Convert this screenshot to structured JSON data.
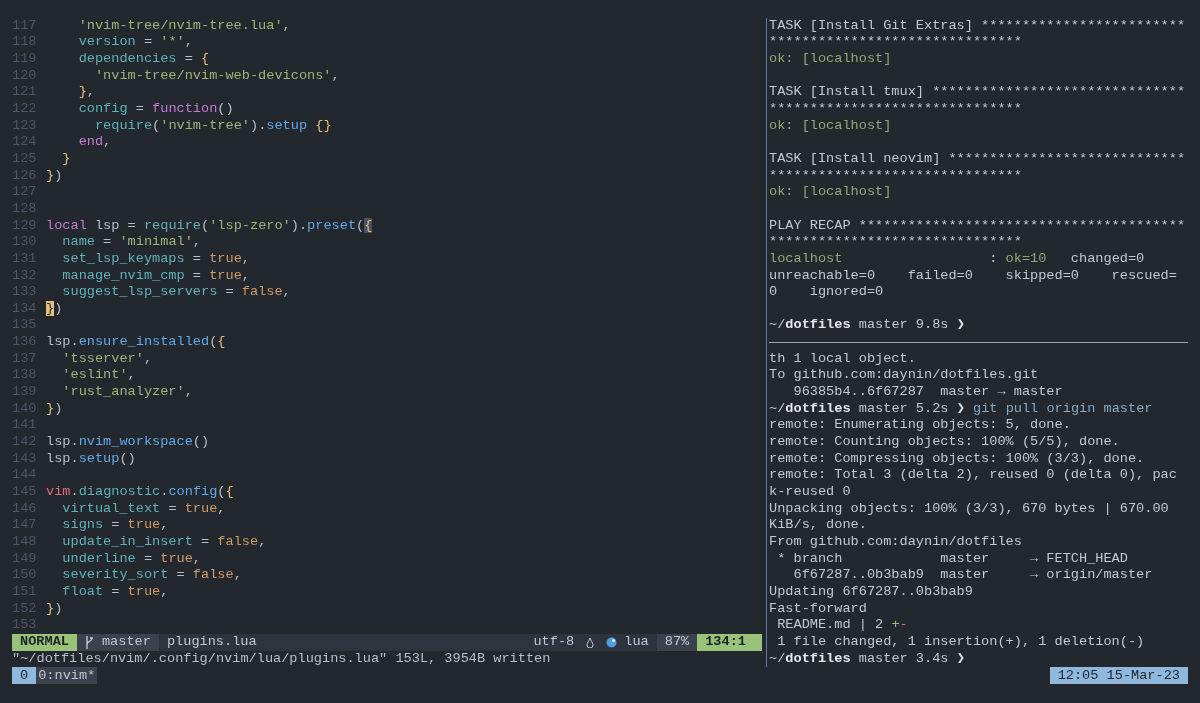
{
  "editor": {
    "lines": [
      {
        "number": "117",
        "tokens": [
          {
            "text": "    'nvim-tree/nvim-tree.lua'",
            "kind": "string"
          },
          {
            "text": ",",
            "kind": "plain"
          }
        ]
      },
      {
        "number": "118",
        "tokens": [
          {
            "text": "    version",
            "kind": "key"
          },
          {
            "text": " = ",
            "kind": "plain"
          },
          {
            "text": "'*'",
            "kind": "string"
          },
          {
            "text": ",",
            "kind": "plain"
          }
        ]
      },
      {
        "number": "119",
        "tokens": [
          {
            "text": "    dependencies",
            "kind": "key"
          },
          {
            "text": " = ",
            "kind": "plain"
          },
          {
            "text": "{",
            "kind": "brace"
          }
        ]
      },
      {
        "number": "120",
        "tokens": [
          {
            "text": "      'nvim-tree/nvim-web-devicons'",
            "kind": "string"
          },
          {
            "text": ",",
            "kind": "plain"
          }
        ]
      },
      {
        "number": "121",
        "tokens": [
          {
            "text": "    }",
            "kind": "brace"
          },
          {
            "text": ",",
            "kind": "plain"
          }
        ]
      },
      {
        "number": "122",
        "tokens": [
          {
            "text": "    config",
            "kind": "key"
          },
          {
            "text": " = ",
            "kind": "plain"
          },
          {
            "text": "function",
            "kind": "keyword"
          },
          {
            "text": "()",
            "kind": "plain"
          }
        ]
      },
      {
        "number": "123",
        "tokens": [
          {
            "text": "      require",
            "kind": "key"
          },
          {
            "text": "(",
            "kind": "plain"
          },
          {
            "text": "'nvim-tree'",
            "kind": "string"
          },
          {
            "text": ").",
            "kind": "plain"
          },
          {
            "text": "setup",
            "kind": "func"
          },
          {
            "text": " {}",
            "kind": "brace"
          }
        ]
      },
      {
        "number": "124",
        "tokens": [
          {
            "text": "    end",
            "kind": "keyword"
          },
          {
            "text": ",",
            "kind": "plain"
          }
        ]
      },
      {
        "number": "125",
        "tokens": [
          {
            "text": "  }",
            "kind": "brace"
          }
        ]
      },
      {
        "number": "126",
        "tokens": [
          {
            "text": "}",
            "kind": "brace"
          },
          {
            "text": ")",
            "kind": "plain"
          }
        ]
      },
      {
        "number": "127"
      },
      {
        "number": "128"
      },
      {
        "number": "129",
        "tokens": [
          {
            "text": "local",
            "kind": "keyword"
          },
          {
            "text": " lsp = ",
            "kind": "plain"
          },
          {
            "text": "require",
            "kind": "key"
          },
          {
            "text": "(",
            "kind": "plain"
          },
          {
            "text": "'lsp-zero'",
            "kind": "string"
          },
          {
            "text": ").",
            "kind": "plain"
          },
          {
            "text": "preset",
            "kind": "func"
          },
          {
            "text": "(",
            "kind": "plain"
          },
          {
            "text": "{",
            "kind": "match"
          }
        ]
      },
      {
        "number": "130",
        "tokens": [
          {
            "text": "  name",
            "kind": "key"
          },
          {
            "text": " = ",
            "kind": "plain"
          },
          {
            "text": "'minimal'",
            "kind": "string"
          },
          {
            "text": ",",
            "kind": "plain"
          }
        ]
      },
      {
        "number": "131",
        "tokens": [
          {
            "text": "  set_lsp_keymaps",
            "kind": "key"
          },
          {
            "text": " = ",
            "kind": "plain"
          },
          {
            "text": "true",
            "kind": "bool"
          },
          {
            "text": ",",
            "kind": "plain"
          }
        ]
      },
      {
        "number": "132",
        "tokens": [
          {
            "text": "  manage_nvim_cmp",
            "kind": "key"
          },
          {
            "text": " = ",
            "kind": "plain"
          },
          {
            "text": "true",
            "kind": "bool"
          },
          {
            "text": ",",
            "kind": "plain"
          }
        ]
      },
      {
        "number": "133",
        "tokens": [
          {
            "text": "  suggest_lsp_servers",
            "kind": "key"
          },
          {
            "text": " = ",
            "kind": "plain"
          },
          {
            "text": "false",
            "kind": "bool"
          },
          {
            "text": ",",
            "kind": "plain"
          }
        ]
      },
      {
        "number": "134",
        "tokens": [
          {
            "text": "}",
            "kind": "cursor"
          },
          {
            "text": ")",
            "kind": "plain"
          }
        ]
      },
      {
        "number": "135"
      },
      {
        "number": "136",
        "tokens": [
          {
            "text": "lsp.",
            "kind": "plain"
          },
          {
            "text": "ensure_installed",
            "kind": "func"
          },
          {
            "text": "(",
            "kind": "plain"
          },
          {
            "text": "{",
            "kind": "brace"
          }
        ]
      },
      {
        "number": "137",
        "tokens": [
          {
            "text": "  'tsserver'",
            "kind": "string"
          },
          {
            "text": ",",
            "kind": "plain"
          }
        ]
      },
      {
        "number": "138",
        "tokens": [
          {
            "text": "  'eslint'",
            "kind": "string"
          },
          {
            "text": ",",
            "kind": "plain"
          }
        ]
      },
      {
        "number": "139",
        "tokens": [
          {
            "text": "  'rust_analyzer'",
            "kind": "string"
          },
          {
            "text": ",",
            "kind": "plain"
          }
        ]
      },
      {
        "number": "140",
        "tokens": [
          {
            "text": "}",
            "kind": "brace"
          },
          {
            "text": ")",
            "kind": "plain"
          }
        ]
      },
      {
        "number": "141"
      },
      {
        "number": "142",
        "tokens": [
          {
            "text": "lsp.",
            "kind": "plain"
          },
          {
            "text": "nvim_workspace",
            "kind": "func"
          },
          {
            "text": "()",
            "kind": "plain"
          }
        ]
      },
      {
        "number": "143",
        "tokens": [
          {
            "text": "lsp.",
            "kind": "plain"
          },
          {
            "text": "setup",
            "kind": "func"
          },
          {
            "text": "()",
            "kind": "plain"
          }
        ]
      },
      {
        "number": "144"
      },
      {
        "number": "145",
        "tokens": [
          {
            "text": "vim",
            "kind": "var"
          },
          {
            "text": ".",
            "kind": "plain"
          },
          {
            "text": "diagnostic",
            "kind": "key"
          },
          {
            "text": ".",
            "kind": "plain"
          },
          {
            "text": "config",
            "kind": "func"
          },
          {
            "text": "(",
            "kind": "plain"
          },
          {
            "text": "{",
            "kind": "brace"
          }
        ]
      },
      {
        "number": "146",
        "tokens": [
          {
            "text": "  virtual_text",
            "kind": "key"
          },
          {
            "text": " = ",
            "kind": "plain"
          },
          {
            "text": "true",
            "kind": "bool"
          },
          {
            "text": ",",
            "kind": "plain"
          }
        ]
      },
      {
        "number": "147",
        "tokens": [
          {
            "text": "  signs",
            "kind": "key"
          },
          {
            "text": " = ",
            "kind": "plain"
          },
          {
            "text": "true",
            "kind": "bool"
          },
          {
            "text": ",",
            "kind": "plain"
          }
        ]
      },
      {
        "number": "148",
        "tokens": [
          {
            "text": "  update_in_insert",
            "kind": "key"
          },
          {
            "text": " = ",
            "kind": "plain"
          },
          {
            "text": "false",
            "kind": "bool"
          },
          {
            "text": ",",
            "kind": "plain"
          }
        ]
      },
      {
        "number": "149",
        "tokens": [
          {
            "text": "  underline",
            "kind": "key"
          },
          {
            "text": " = ",
            "kind": "plain"
          },
          {
            "text": "true",
            "kind": "bool"
          },
          {
            "text": ",",
            "kind": "plain"
          }
        ]
      },
      {
        "number": "150",
        "tokens": [
          {
            "text": "  severity_sort",
            "kind": "key"
          },
          {
            "text": " = ",
            "kind": "plain"
          },
          {
            "text": "false",
            "kind": "bool"
          },
          {
            "text": ",",
            "kind": "plain"
          }
        ]
      },
      {
        "number": "151",
        "tokens": [
          {
            "text": "  float",
            "kind": "key"
          },
          {
            "text": " = ",
            "kind": "plain"
          },
          {
            "text": "true",
            "kind": "bool"
          },
          {
            "text": ",",
            "kind": "plain"
          }
        ]
      },
      {
        "number": "152",
        "tokens": [
          {
            "text": "}",
            "kind": "brace"
          },
          {
            "text": ")",
            "kind": "plain"
          }
        ]
      },
      {
        "number": "153"
      }
    ],
    "status_line": {
      "mode": "NORMAL",
      "branch": "master",
      "file": "plugins.lua",
      "encoding": "utf-8",
      "filetype": "lua",
      "percent": "87%",
      "position": "134:1"
    },
    "message": "\"~/dotfiles/nvim/.config/nvim/lua/plugins.lua\" 153L, 3954B written"
  },
  "top_pane": {
    "lines": [
      {
        "segments": [
          {
            "text": "TASK [Install Git Extras] *************************",
            "kind": "plain"
          }
        ]
      },
      {
        "segments": [
          {
            "text": "*******************************",
            "kind": "plain"
          }
        ]
      },
      {
        "segments": [
          {
            "text": "ok: [localhost]",
            "kind": "ok"
          }
        ]
      },
      {
        "blank": true
      },
      {
        "segments": [
          {
            "text": "TASK [Install tmux] *******************************",
            "kind": "plain"
          }
        ]
      },
      {
        "segments": [
          {
            "text": "*******************************",
            "kind": "plain"
          }
        ]
      },
      {
        "segments": [
          {
            "text": "ok: [localhost]",
            "kind": "ok"
          }
        ]
      },
      {
        "blank": true
      },
      {
        "segments": [
          {
            "text": "TASK [Install neovim] *****************************",
            "kind": "plain"
          }
        ]
      },
      {
        "segments": [
          {
            "text": "*******************************",
            "kind": "plain"
          }
        ]
      },
      {
        "segments": [
          {
            "text": "ok: [localhost]",
            "kind": "ok"
          }
        ]
      },
      {
        "blank": true
      },
      {
        "segments": [
          {
            "text": "PLAY RECAP ****************************************",
            "kind": "plain"
          }
        ]
      },
      {
        "segments": [
          {
            "text": "*******************************",
            "kind": "plain"
          }
        ]
      },
      {
        "segments": [
          {
            "text": "localhost",
            "kind": "ok"
          },
          {
            "text": "                  : ",
            "kind": "plain"
          },
          {
            "text": "ok=10",
            "kind": "ok"
          },
          {
            "text": "   changed=0",
            "kind": "plain"
          }
        ]
      },
      {
        "segments": [
          {
            "text": "unreachable=0    failed=0    skipped=0    rescued=",
            "kind": "plain"
          }
        ]
      },
      {
        "segments": [
          {
            "text": "0    ignored=0",
            "kind": "plain"
          }
        ]
      },
      {
        "blank": true
      },
      {
        "segments": [
          {
            "text": "~/",
            "kind": "plain"
          },
          {
            "text": "dotfiles",
            "kind": "bold"
          },
          {
            "text": " master 9.8s",
            "kind": "plain"
          },
          {
            "text": " ❯",
            "kind": "bold"
          }
        ]
      }
    ]
  },
  "bottom_pane": {
    "lines": [
      {
        "segments": [
          {
            "text": "th 1 local object.",
            "kind": "plain"
          }
        ]
      },
      {
        "segments": [
          {
            "text": "To github.com:daynin/dotfiles.git",
            "kind": "plain"
          }
        ]
      },
      {
        "segments": [
          {
            "text": "   96385b4..6f67287  master → master",
            "kind": "plain"
          }
        ]
      },
      {
        "segments": [
          {
            "text": "~/",
            "kind": "plain"
          },
          {
            "text": "dotfiles",
            "kind": "bold"
          },
          {
            "text": " master 5.2s",
            "kind": "plain"
          },
          {
            "text": " ❯",
            "kind": "bold"
          },
          {
            "text": " git pull origin master",
            "kind": "command"
          }
        ]
      },
      {
        "segments": [
          {
            "text": "remote: Enumerating objects: 5, done.",
            "kind": "plain"
          }
        ]
      },
      {
        "segments": [
          {
            "text": "remote: Counting objects: 100% (5/5), done.",
            "kind": "plain"
          }
        ]
      },
      {
        "segments": [
          {
            "text": "remote: Compressing objects: 100% (3/3), done.",
            "kind": "plain"
          }
        ]
      },
      {
        "segments": [
          {
            "text": "remote: Total 3 (delta 2), reused 0 (delta 0), pac",
            "kind": "plain"
          }
        ]
      },
      {
        "segments": [
          {
            "text": "k-reused 0",
            "kind": "plain"
          }
        ]
      },
      {
        "segments": [
          {
            "text": "Unpacking objects: 100% (3/3), 670 bytes | 670.00",
            "kind": "plain"
          }
        ]
      },
      {
        "segments": [
          {
            "text": "KiB/s, done.",
            "kind": "plain"
          }
        ]
      },
      {
        "segments": [
          {
            "text": "From github.com:daynin/dotfiles",
            "kind": "plain"
          }
        ]
      },
      {
        "segments": [
          {
            "text": " * branch            master     → FETCH_HEAD",
            "kind": "plain"
          }
        ]
      },
      {
        "segments": [
          {
            "text": "   6f67287..0b3bab9  master     → origin/master",
            "kind": "plain"
          }
        ]
      },
      {
        "segments": [
          {
            "text": "Updating 6f67287..0b3bab9",
            "kind": "plain"
          }
        ]
      },
      {
        "segments": [
          {
            "text": "Fast-forward",
            "kind": "plain"
          }
        ]
      },
      {
        "segments": [
          {
            "text": " README.md | 2 ",
            "kind": "plain"
          },
          {
            "text": "+",
            "kind": "add"
          },
          {
            "text": "-",
            "kind": "del"
          }
        ]
      },
      {
        "segments": [
          {
            "text": " 1 file changed, 1 insertion(+), 1 deletion(-)",
            "kind": "plain"
          }
        ]
      },
      {
        "segments": [
          {
            "text": "~/",
            "kind": "plain"
          },
          {
            "text": "dotfiles",
            "kind": "bold"
          },
          {
            "text": " master 3.4s",
            "kind": "plain"
          },
          {
            "text": " ❯",
            "kind": "bold"
          }
        ]
      }
    ]
  },
  "tmux_bar": {
    "session": "0",
    "windows": [
      {
        "label": "0:nvim*",
        "selected": true
      }
    ],
    "clock": "12:05 15-Mar-23"
  }
}
